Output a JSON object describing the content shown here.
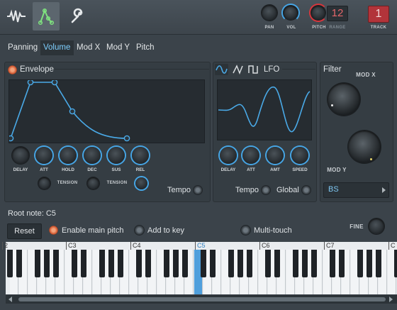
{
  "top": {
    "pan_label": "PAN",
    "vol_label": "VOL",
    "pitch_label": "PITCH",
    "range_label": "RANGE",
    "range_value": "12",
    "track_label": "TRACK",
    "track_value": "1"
  },
  "tabs": [
    "Panning",
    "Volume",
    "Mod X",
    "Mod Y",
    "Pitch"
  ],
  "envelope": {
    "title": "Envelope",
    "knobs": [
      "DELAY",
      "ATT",
      "HOLD",
      "DEC",
      "SUS",
      "REL"
    ],
    "tension1": "TENSION",
    "tension2": "TENSION",
    "tempo": "Tempo"
  },
  "lfo": {
    "title": "LFO",
    "knobs": [
      "DELAY",
      "ATT",
      "AMT",
      "SPEED"
    ],
    "tempo": "Tempo",
    "global": "Global"
  },
  "filter": {
    "title": "Filter",
    "modx": "MOD X",
    "mody": "MOD Y",
    "type": "BS"
  },
  "root_note": "Root note: C5",
  "reset": "Reset",
  "enable_main_pitch": "Enable main pitch",
  "add_to_key": "Add to key",
  "multi_touch": "Multi-touch",
  "fine": "FINE",
  "octaves": [
    "2",
    "C3",
    "C4",
    "C5",
    "C6",
    "C7",
    "C"
  ],
  "colors": {
    "accent": "#46a6e6",
    "active_key": "#4f9fdc",
    "range_red": "#d8353b"
  }
}
